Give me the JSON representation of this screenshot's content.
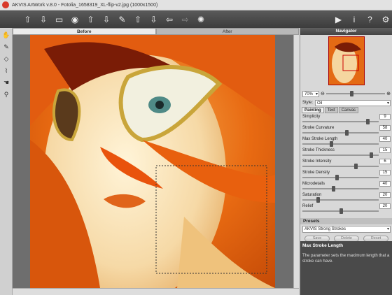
{
  "window": {
    "title": "AKVIS ArtWork v.8.0 - Fotolia_1658319_XL-flip-v2.jpg (1000x1500)"
  },
  "toolbar": {
    "icons": [
      "open-icon",
      "save-icon",
      "print-icon",
      "share-icon",
      "batch-icon",
      "apply-icon",
      "brush-icon",
      "before-icon",
      "after-icon",
      "undo-icon",
      "redo-icon",
      "settings-icon"
    ],
    "right_icons": [
      "run-icon",
      "info-icon",
      "help-icon",
      "preferences-icon"
    ]
  },
  "tabs": {
    "before": "Before",
    "after": "After"
  },
  "navigator": {
    "title": "Navigator",
    "zoom": "70%"
  },
  "style": {
    "label": "Style:",
    "value": "Oil"
  },
  "panel_tabs": [
    "Painting",
    "Text",
    "Canvas"
  ],
  "params": [
    {
      "label": "Simplicity",
      "value": "9",
      "fraction": 0.85
    },
    {
      "label": "Stroke Curvature",
      "value": "58",
      "fraction": 0.58
    },
    {
      "label": "Max Stroke Length",
      "value": "40",
      "fraction": 0.38
    },
    {
      "label": "Stroke Thickness",
      "value": "15",
      "fraction": 0.9
    },
    {
      "label": "Stroke Intensity",
      "value": "6",
      "fraction": 0.7
    },
    {
      "label": "Stroke Density",
      "value": "15",
      "fraction": 0.45
    },
    {
      "label": "Microdetails",
      "value": "40",
      "fraction": 0.4
    },
    {
      "label": "Saturation",
      "value": "20",
      "fraction": 0.2
    },
    {
      "label": "Relief",
      "value": "20",
      "fraction": 0.5
    }
  ],
  "presets": {
    "title": "Presets",
    "selected": "AKVIS Strong Strokes",
    "save": "Save",
    "delete": "Delete",
    "reset": "Reset"
  },
  "help": {
    "title": "Max Stroke Length",
    "body": "The parameter sets the maximum length that a stroke can have."
  }
}
